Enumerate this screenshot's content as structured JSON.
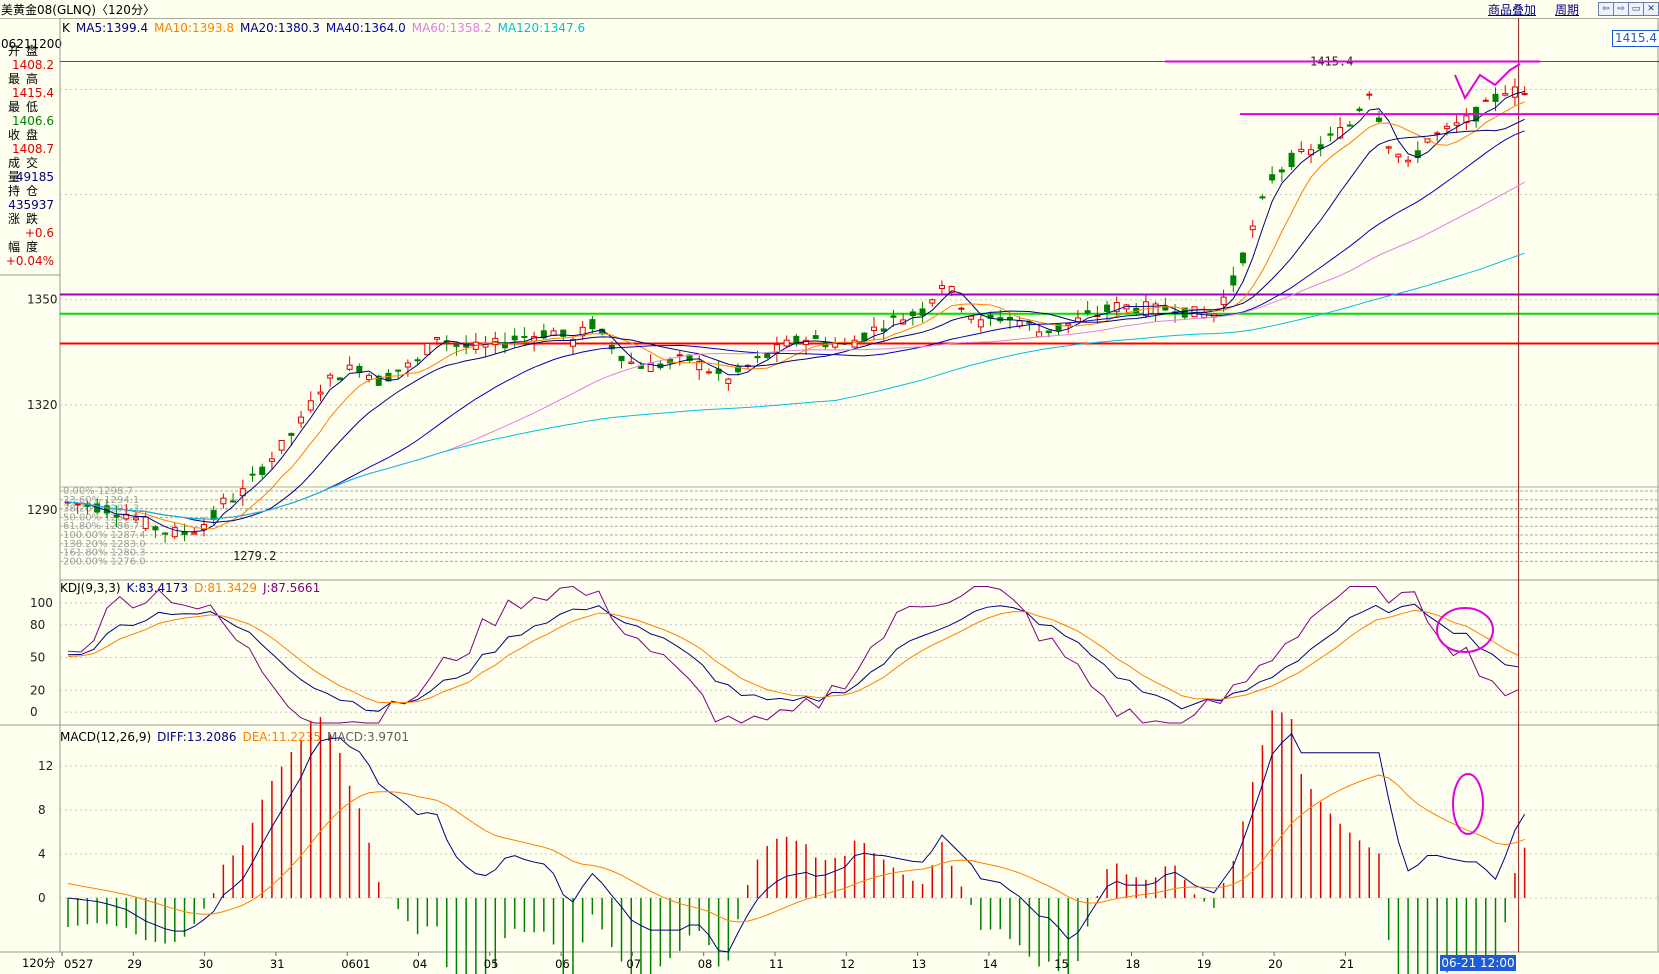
{
  "window": {
    "title": "美黄金08(GLNQ)〈120分〉",
    "btn_overlay": "商品叠加",
    "btn_period": "周期",
    "win_buttons": [
      "⇦",
      "⇨",
      "▭",
      "✕"
    ]
  },
  "info": {
    "datetime": "06211200",
    "rows": [
      {
        "label": "开盘",
        "value": "1408.2",
        "color": "#e00000"
      },
      {
        "label": "最高",
        "value": "1415.4",
        "color": "#e00000"
      },
      {
        "label": "最低",
        "value": "1406.6",
        "color": "#008000"
      },
      {
        "label": "收盘",
        "value": "1408.7",
        "color": "#e00000"
      },
      {
        "label": "成交量",
        "value": "49185",
        "color": "#000080"
      },
      {
        "label": "持仓",
        "value": "435937",
        "color": "#000080"
      },
      {
        "label": "涨跌",
        "value": "+0.6",
        "color": "#e00000"
      },
      {
        "label": "幅度",
        "value": "+0.04%",
        "color": "#e00000"
      }
    ]
  },
  "legend_ma": {
    "k": "K",
    "items": [
      {
        "text": "MA5:1399.4",
        "color": "#000080"
      },
      {
        "text": "MA10:1393.8",
        "color": "#ff8000"
      },
      {
        "text": "MA20:1380.3",
        "color": "#000080"
      },
      {
        "text": "MA40:1364.0",
        "color": "#0000c0"
      },
      {
        "text": "MA60:1358.2",
        "color": "#e080e0"
      },
      {
        "text": "MA120:1347.6",
        "color": "#00c0e0"
      }
    ]
  },
  "legend_kdj": {
    "name": "KDJ(9,3,3)",
    "items": [
      {
        "text": "K:83.4173",
        "color": "#000080"
      },
      {
        "text": "D:81.3429",
        "color": "#ff8000"
      },
      {
        "text": "J:87.5661",
        "color": "#800080"
      }
    ]
  },
  "legend_macd": {
    "name": "MACD(12,26,9)",
    "items": [
      {
        "text": "DIFF:13.2086",
        "color": "#000080"
      },
      {
        "text": "DEA:11.2235",
        "color": "#ff8000"
      },
      {
        "text": "MACD:3.9701",
        "color": "#606060"
      }
    ]
  },
  "labels": {
    "high_mark": "1415.4",
    "low_mark": "1279.2",
    "price_box": "1415.4",
    "date_box": "06-21 12:00",
    "period": "120分"
  },
  "fib_levels": [
    {
      "text": "0.00% 1298.7"
    },
    {
      "text": "23.60% 1294.1"
    },
    {
      "text": "38.20% 1291.3"
    },
    {
      "text": "50.00% 1289.0"
    },
    {
      "text": "61.80% 1286.7"
    },
    {
      "text": "100.00% 1287.4"
    },
    {
      "text": "138.20% 1283.0"
    },
    {
      "text": "161.80% 1280.3"
    },
    {
      "text": "200.00% 1276.0"
    }
  ],
  "chart_data": [
    {
      "type": "candlestick",
      "title": "美黄金08(GLNQ)〈120分〉",
      "y_ticks": [
        1290,
        1320,
        1350
      ],
      "ylim": [
        1270,
        1425
      ],
      "x_ticks": [
        "0527",
        "29",
        "30",
        "31",
        "0601",
        "04",
        "05",
        "06",
        "07",
        "08",
        "11",
        "12",
        "13",
        "14",
        "15",
        "18",
        "19",
        "20",
        "21"
      ],
      "horizontal_lines": [
        {
          "value": 1351.5,
          "color": "#9900cc"
        },
        {
          "value": 1346,
          "color": "#00dd00"
        },
        {
          "value": 1337.5,
          "color": "#ff0000"
        }
      ],
      "series_names": [
        "MA5",
        "MA10",
        "MA20",
        "MA40",
        "MA60",
        "MA120"
      ],
      "close_path": [
        [
          0,
          1292
        ],
        [
          10,
          1291
        ],
        [
          18,
          1289
        ],
        [
          24,
          1286
        ],
        [
          30,
          1284
        ],
        [
          35,
          1283
        ],
        [
          40,
          1285
        ],
        [
          45,
          1288
        ],
        [
          48,
          1292
        ],
        [
          54,
          1295
        ],
        [
          60,
          1302
        ],
        [
          66,
          1308
        ],
        [
          72,
          1315
        ],
        [
          78,
          1325
        ],
        [
          84,
          1329
        ],
        [
          90,
          1331
        ],
        [
          96,
          1327
        ],
        [
          102,
          1330
        ],
        [
          108,
          1332
        ],
        [
          114,
          1340
        ],
        [
          120,
          1337
        ],
        [
          126,
          1336
        ],
        [
          132,
          1337
        ],
        [
          138,
          1339
        ],
        [
          144,
          1340
        ],
        [
          150,
          1341
        ],
        [
          156,
          1338
        ],
        [
          162,
          1343
        ],
        [
          168,
          1337
        ],
        [
          174,
          1332
        ],
        [
          180,
          1331
        ],
        [
          186,
          1332
        ],
        [
          192,
          1333
        ],
        [
          198,
          1330
        ],
        [
          204,
          1327
        ],
        [
          210,
          1331
        ],
        [
          216,
          1334
        ],
        [
          222,
          1337
        ],
        [
          228,
          1339
        ],
        [
          234,
          1338
        ],
        [
          240,
          1337
        ],
        [
          246,
          1340
        ],
        [
          252,
          1343
        ],
        [
          258,
          1345
        ],
        [
          264,
          1347
        ],
        [
          270,
          1355
        ],
        [
          276,
          1349
        ],
        [
          282,
          1343
        ],
        [
          288,
          1345
        ],
        [
          294,
          1344
        ],
        [
          300,
          1341
        ],
        [
          306,
          1342
        ],
        [
          312,
          1344
        ],
        [
          318,
          1346
        ],
        [
          324,
          1348
        ],
        [
          330,
          1348
        ],
        [
          336,
          1347
        ],
        [
          342,
          1348
        ],
        [
          348,
          1346
        ],
        [
          354,
          1346
        ],
        [
          360,
          1355
        ],
        [
          366,
          1370
        ],
        [
          372,
          1385
        ],
        [
          378,
          1390
        ],
        [
          384,
          1392
        ],
        [
          390,
          1396
        ],
        [
          396,
          1400
        ],
        [
          402,
          1410
        ],
        [
          408,
          1395
        ],
        [
          414,
          1388
        ],
        [
          420,
          1396
        ],
        [
          426,
          1398
        ],
        [
          432,
          1401
        ],
        [
          438,
          1405
        ],
        [
          444,
          1410
        ],
        [
          450,
          1408.7
        ]
      ]
    },
    {
      "type": "line",
      "title": "KDJ(9,3,3)",
      "y_ticks": [
        0,
        20,
        50,
        80,
        100
      ],
      "series": [
        {
          "name": "K",
          "color": "#000080"
        },
        {
          "name": "D",
          "color": "#ff8000"
        },
        {
          "name": "J",
          "color": "#800080"
        }
      ]
    },
    {
      "type": "bar+line",
      "title": "MACD(12,26,9)",
      "y_ticks": [
        0,
        4,
        8,
        12
      ],
      "series": [
        {
          "name": "DIFF",
          "color": "#000080"
        },
        {
          "name": "DEA",
          "color": "#ff8000"
        },
        {
          "name": "MACD",
          "color": "#606060"
        }
      ]
    }
  ]
}
